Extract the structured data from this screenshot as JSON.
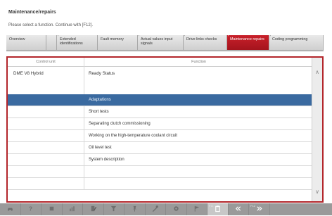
{
  "header": {
    "title": "Maintenance/repairs",
    "subtitle": "Please select a function. Continue with [F12]."
  },
  "tabs": [
    {
      "label": "Overview",
      "active": false
    },
    {
      "label": "Extended identifications",
      "active": false
    },
    {
      "label": "Fault memory",
      "active": false
    },
    {
      "label": "Actual values input signals",
      "active": false
    },
    {
      "label": "Drive links checks",
      "active": false
    },
    {
      "label": "Maintenance repairs",
      "active": true
    },
    {
      "label": "Coding programming",
      "active": false
    }
  ],
  "table": {
    "columns": [
      "Control unit",
      "Function"
    ],
    "control_unit": "DME V8 Hybrid",
    "status": "Ready Status",
    "rows": [
      {
        "function": "Adaptations",
        "selected": true
      },
      {
        "function": "Short tests",
        "selected": false
      },
      {
        "function": "Separating clutch commissioning",
        "selected": false
      },
      {
        "function": "Working on the high-temperature coolant circuit",
        "selected": false
      },
      {
        "function": "Oil level test",
        "selected": false
      },
      {
        "function": "System description",
        "selected": false
      },
      {
        "function": "",
        "selected": false
      },
      {
        "function": "",
        "selected": false
      }
    ]
  },
  "toolbar": {
    "buttons": [
      {
        "icon": "car-icon",
        "fkey": ""
      },
      {
        "icon": "help-icon",
        "fkey": ""
      },
      {
        "icon": "list-icon",
        "fkey": ""
      },
      {
        "icon": "chart-icon",
        "fkey": ""
      },
      {
        "icon": "document-edit-icon",
        "fkey": ""
      },
      {
        "icon": "filter-icon",
        "fkey": ""
      },
      {
        "icon": "pin-icon",
        "fkey": ""
      },
      {
        "icon": "tools-icon",
        "fkey": ""
      },
      {
        "icon": "settings-icon",
        "fkey": ""
      },
      {
        "icon": "flag-icon",
        "fkey": ""
      },
      {
        "icon": "clipboard-icon",
        "fkey": "F11"
      },
      {
        "icon": "back-icon",
        "fkey": ""
      },
      {
        "icon": "forward-icon",
        "fkey": "F12"
      }
    ]
  }
}
